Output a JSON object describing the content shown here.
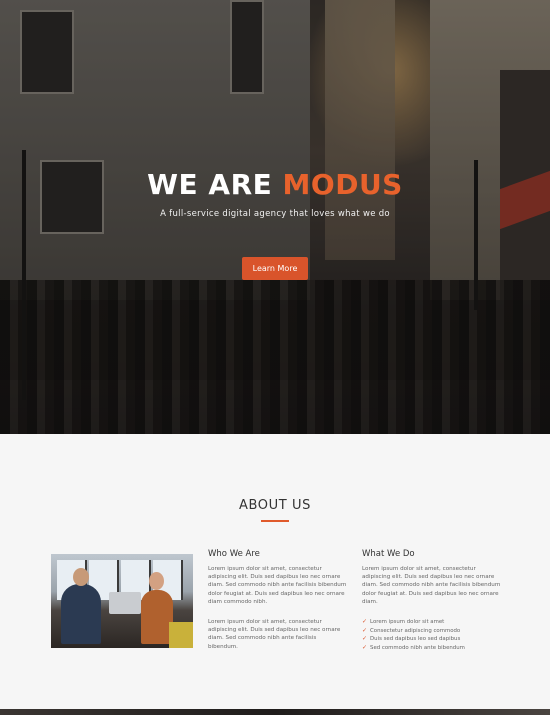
{
  "hero": {
    "title_main": "WE ARE ",
    "title_accent": "MODUS",
    "subtitle": "A full-service digital agency that loves what we do",
    "button_label": "Learn More"
  },
  "about": {
    "title": "ABOUT US",
    "who": {
      "heading": "Who We Are",
      "para1": "Lorem ipsum dolor sit amet, consectetur adipiscing elit. Duis sed dapibus leo nec ornare diam. Sed commodo nibh ante facilisis bibendum dolor feugiat at. Duis sed dapibus leo nec ornare diam commodo nibh.",
      "para2": "Lorem ipsum dolor sit amet, consectetur adipiscing elit. Duis sed dapibus leo nec ornare diam. Sed commodo nibh ante facilisis bibendum."
    },
    "what": {
      "heading": "What We Do",
      "para1": "Lorem ipsum dolor sit amet, consectetur adipiscing elit. Duis sed dapibus leo nec ornare diam. Sed commodo nibh ante facilisis bibendum dolor feugiat at. Duis sed dapibus leo nec ornare diam.",
      "list": [
        "Lorem ipsum dolor sit amet",
        "Consectetur adipiscing commodo",
        "Duis sed dapibus leo sed dapibus",
        "Sed commodo nibh ante bibendum"
      ]
    }
  },
  "colors": {
    "accent": "#e8622c",
    "button": "#d9542b"
  }
}
